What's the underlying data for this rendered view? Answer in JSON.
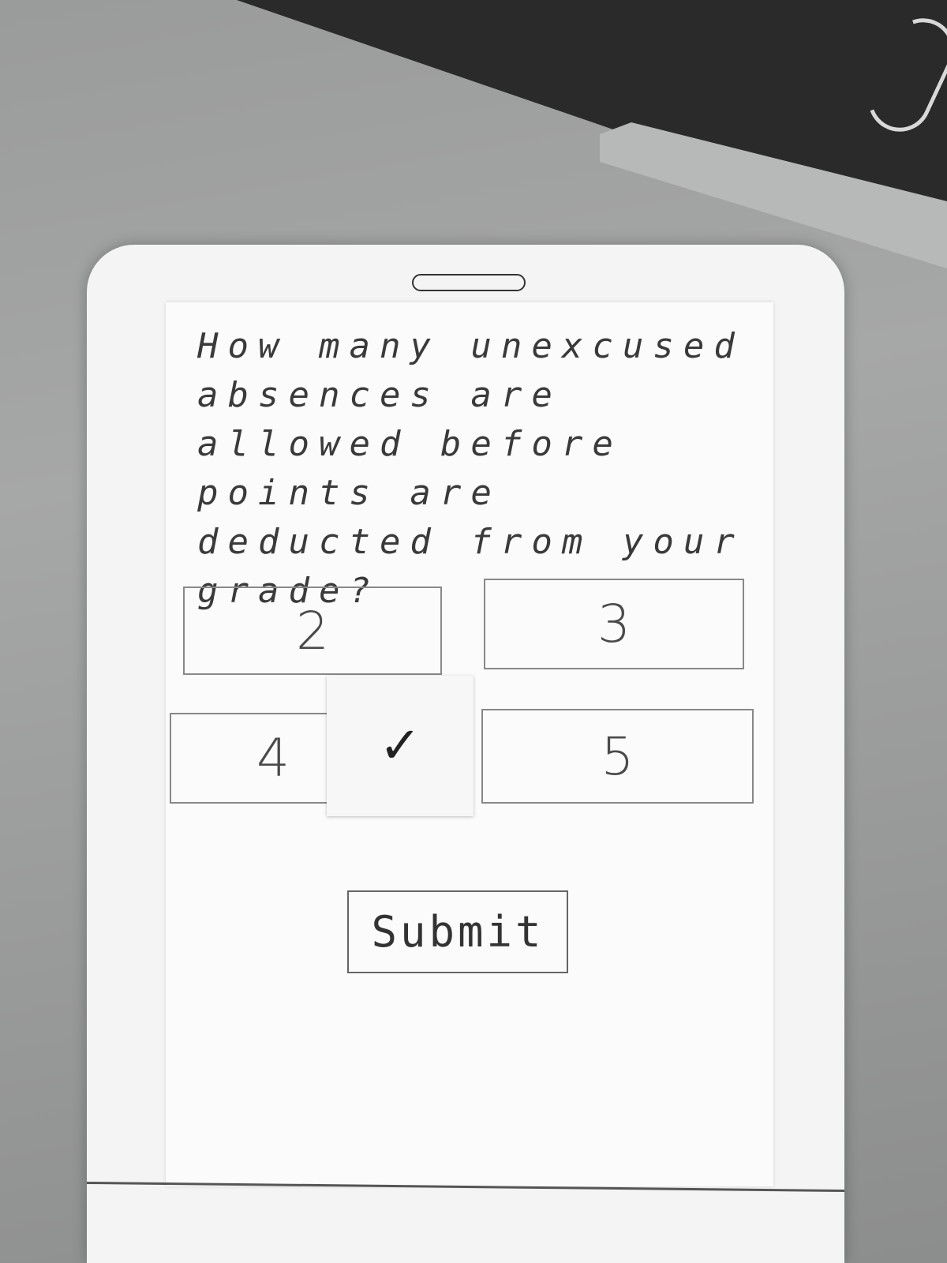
{
  "question": {
    "text": "How many unexcused absences are allowed before points are deducted from your grade?"
  },
  "options": [
    {
      "label": "2",
      "selected": false
    },
    {
      "label": "3",
      "selected": false
    },
    {
      "label": "4",
      "selected": true
    },
    {
      "label": "5",
      "selected": false
    }
  ],
  "selection_mark": "✓",
  "submit": {
    "label": "Submit"
  },
  "colors": {
    "paper": "#fbfbfb",
    "ink": "#3a3a3a",
    "desk": "#9a9b9b"
  }
}
